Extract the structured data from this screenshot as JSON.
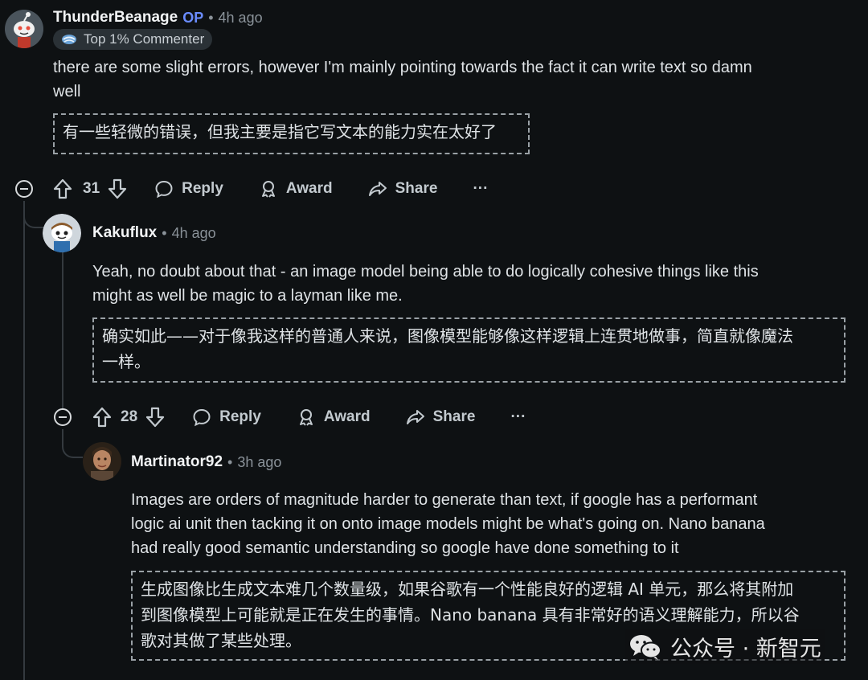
{
  "comments": [
    {
      "author": "ThunderBeanage",
      "op_label": "OP",
      "separator": "•",
      "time": "4h ago",
      "badge": "Top 1% Commenter",
      "avatar_icon": "snoo-avatar-icon",
      "body_lines": [
        "there are some slight errors, however I'm mainly pointing towards the fact it can write text so damn",
        "well"
      ],
      "translation": "有一些轻微的错误，但我主要是指它写文本的能力实在太好了",
      "votes": "31",
      "actions": {
        "reply": "Reply",
        "award": "Award",
        "share": "Share",
        "more": "···"
      }
    },
    {
      "author": "Kakuflux",
      "separator": "•",
      "time": "4h ago",
      "avatar_icon": "snoo-avatar-icon",
      "body_lines": [
        "Yeah, no doubt about that - an image model being able to do logically cohesive things like this",
        "might as well be magic to a layman like me."
      ],
      "translation_lines": [
        "确实如此——对于像我这样的普通人来说，图像模型能够像这样逻辑上连贯地做事，简直就像魔法",
        "一样。"
      ],
      "votes": "28",
      "actions": {
        "reply": "Reply",
        "award": "Award",
        "share": "Share",
        "more": "···"
      }
    },
    {
      "author": "Martinator92",
      "separator": "•",
      "time": "3h ago",
      "avatar_icon": "photo-avatar-icon",
      "body_lines": [
        "Images are orders of magnitude harder to generate than text, if google has a performant",
        "logic ai unit then tacking it on onto image models might be what's going on. Nano banana",
        "had really good semantic understanding so google have done something to it"
      ],
      "translation_lines": [
        "生成图像比生成文本难几个数量级，如果谷歌有一个性能良好的逻辑 AI 单元，那么将其附加",
        "到图像模型上可能就是正在发生的事情。Nano banana 具有非常好的语义理解能力，所以谷",
        "歌对其做了某些处理。"
      ]
    }
  ],
  "watermark": {
    "text": "公众号 · 新智元",
    "icon": "wechat-icon"
  },
  "colors": {
    "background": "#0e1113",
    "op": "#6a8cff",
    "muted": "#8a9299",
    "thread_line": "#343a3f"
  }
}
